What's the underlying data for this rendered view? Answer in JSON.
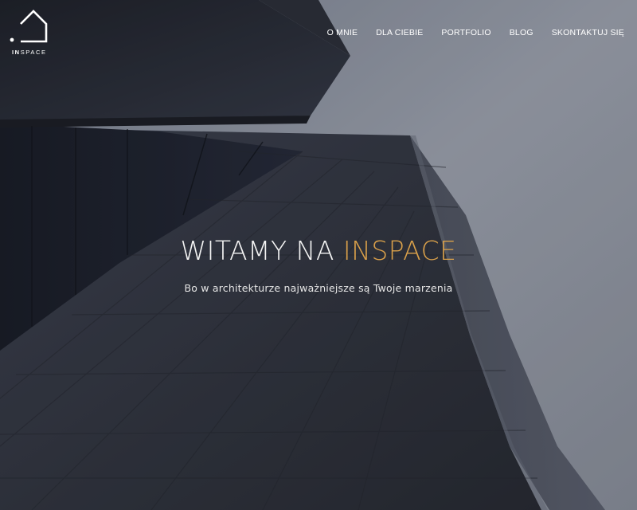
{
  "logo": {
    "text_bold": "IN",
    "text_light": "SPACE"
  },
  "nav": {
    "items": [
      {
        "label": "O MNIE"
      },
      {
        "label": "DLA CIEBIE"
      },
      {
        "label": "PORTFOLIO"
      },
      {
        "label": "BLOG"
      },
      {
        "label": "SKONTAKTUJ SIĘ"
      }
    ]
  },
  "hero": {
    "title_part1": "WITAMY NA ",
    "title_accent": "INSPACE",
    "subtitle": "Bo w architekturze najważniejsze są Twoje marzenia",
    "accent_color": "#d9a04a",
    "image": "building-facade-from-below"
  }
}
